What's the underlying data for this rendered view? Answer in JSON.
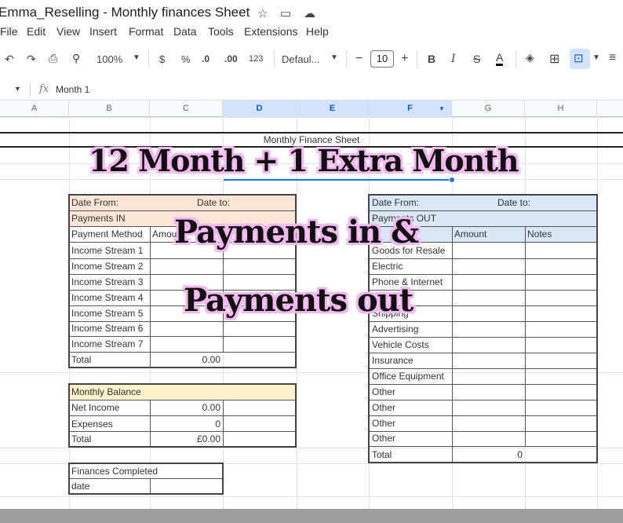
{
  "app": {
    "doc_title": "Emma_Reselling - Monthly finances Sheet",
    "menu": [
      "File",
      "Edit",
      "View",
      "Insert",
      "Format",
      "Data",
      "Tools",
      "Extensions",
      "Help"
    ]
  },
  "toolbar": {
    "zoom": "100%",
    "currency": "$",
    "percent": "%",
    "dec_decrease": ".0",
    "dec_increase": ".00",
    "number_format": "123",
    "font": "Defaul...",
    "font_size": "10",
    "minus": "−",
    "plus": "+",
    "bold": "B",
    "italic": "I",
    "strike": "S",
    "text_color": "A"
  },
  "formula_bar": {
    "fx": "fx",
    "content": "Month 1"
  },
  "columns": [
    "A",
    "B",
    "C",
    "D",
    "E",
    "F",
    "G",
    "H"
  ],
  "sheet": {
    "title": "Monthly Finance Sheet",
    "payments_in": {
      "date_from": "Date From:",
      "date_to": "Date to:",
      "header": "Payments IN",
      "col_method": "Payment Method",
      "col_amount": "Amount",
      "rows": [
        "Income Stream 1",
        "Income Stream 2",
        "Income Stream 3",
        "Income Stream 4",
        "Income Stream 5",
        "Income Stream 6",
        "Income Stream 7"
      ],
      "total_label": "Total",
      "total_value": "0.00"
    },
    "balance": {
      "header": "Monthly Balance",
      "rows": [
        {
          "label": "Net Income",
          "value": "0.00"
        },
        {
          "label": "Expenses",
          "value": "0"
        },
        {
          "label": "Total",
          "value": "£0.00"
        }
      ]
    },
    "completed": {
      "header": "Finances Completed",
      "row_label": "date"
    },
    "payments_out": {
      "date_from": "Date From:",
      "date_to": "Date to:",
      "header": "Payments OUT",
      "col_amount": "Amount",
      "col_notes": "Notes",
      "rows": [
        "Goods for Resale",
        "Electric",
        "Phone & Internet",
        "P",
        "Shipping",
        "Advertising",
        "Vehicle Costs",
        "Insurance",
        "Office Equipment",
        "Other",
        "Other",
        "Other",
        "Other"
      ],
      "total_label": "Total",
      "total_value": "0"
    }
  },
  "overlay": {
    "headline": "12 Month + 1 Extra Month",
    "line1": "Payments in &",
    "line2": "Payments out"
  },
  "colors": {
    "peach": "#fbe5d6",
    "yellow": "#fff2cc",
    "blue": "#dae8f5",
    "overlay_outline": "#f3b8ef"
  }
}
